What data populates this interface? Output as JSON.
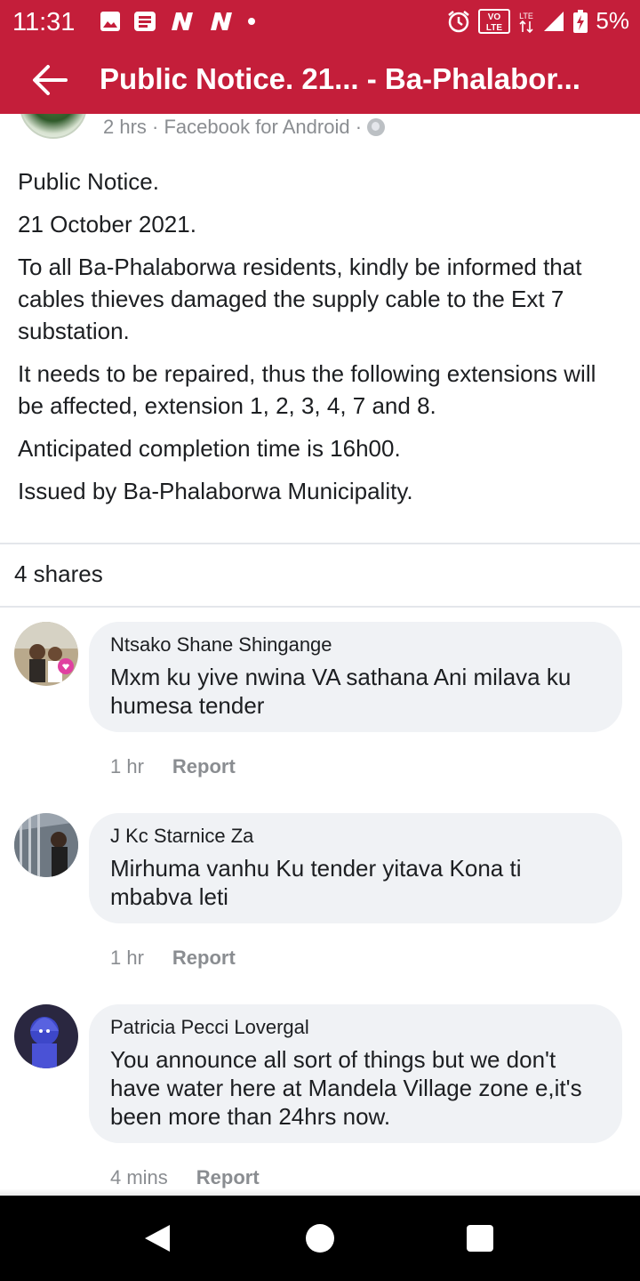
{
  "status_bar": {
    "time": "11:31",
    "battery_percent": "5%",
    "network_badge": "VO LTE",
    "lte_label": "LTE"
  },
  "app_bar": {
    "title": "Public Notice. 21... - Ba-Phalabor..."
  },
  "post": {
    "meta": "2 hrs · Facebook for Android ·",
    "paragraphs": [
      "Public Notice.",
      "21 October 2021.",
      "To all Ba-Phalaborwa residents, kindly be informed that cables thieves damaged the supply cable to the Ext 7 substation.",
      "It needs to be repaired, thus the following extensions will be affected, extension 1, 2, 3, 4, 7 and 8.",
      "Anticipated completion time is 16h00.",
      "Issued by Ba-Phalaborwa Municipality."
    ],
    "shares": "4 shares"
  },
  "comments": [
    {
      "author": "Ntsako Shane Shingange",
      "text": "Mxm ku yive nwina VA sathana Ani milava ku humesa tender",
      "time": "1 hr",
      "report": "Report"
    },
    {
      "author": "J Kc Starnice Za",
      "text": "Mirhuma vanhu Ku tender yitava Kona ti mbabva leti",
      "time": "1 hr",
      "report": "Report"
    },
    {
      "author": "Patricia Pecci Lovergal",
      "text": "You announce all sort of things but we don't have water here at Mandela Village zone e,it's been more than 24hrs now.",
      "time": "4 mins",
      "report": "Report"
    }
  ],
  "colors": {
    "brand": "#c41e3a",
    "bubble": "#f0f2f5",
    "meta": "#8a8d91"
  }
}
